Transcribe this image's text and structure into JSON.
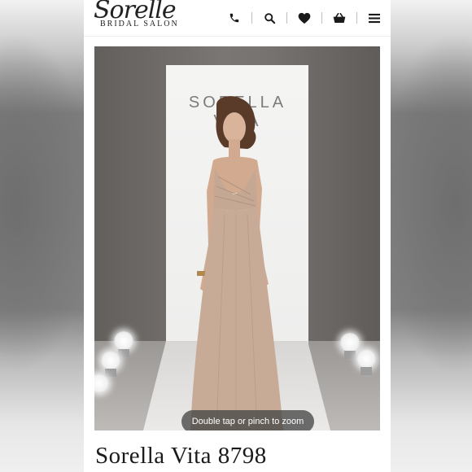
{
  "brand": {
    "logo_script": "Sorelle",
    "logo_subtitle": "BRIDAL SALON"
  },
  "nav": {
    "icons": [
      "phone-icon",
      "search-icon",
      "heart-icon",
      "basket-icon",
      "menu-icon"
    ]
  },
  "product": {
    "image_brand_text": "SORELLA VITA",
    "zoom_hint": "Double tap or pinch to zoom",
    "title": "Sorella Vita 8798"
  },
  "colors": {
    "dress": "#c8ab97",
    "header_bg": "#ffffff",
    "icon": "#1a1a1a"
  }
}
